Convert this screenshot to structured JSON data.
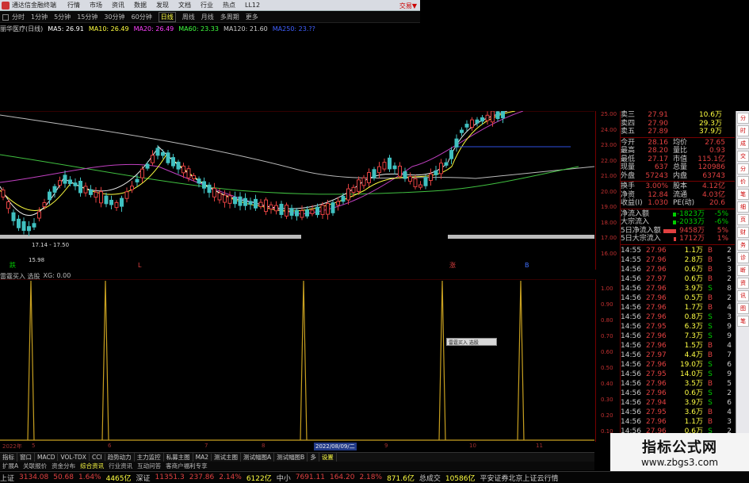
{
  "titlebar": {
    "app_name": "通达信金融终端",
    "menus": [
      "行情",
      "市场",
      "资讯",
      "数据",
      "发现",
      "文档",
      "行业",
      "热点",
      "LL12"
    ],
    "trade": "交易▼"
  },
  "toolbar": {
    "items": [
      "分时",
      "1分钟",
      "5分钟",
      "15分钟",
      "30分钟",
      "60分钟",
      "日线",
      "周线",
      "月线",
      "多周期",
      "更多"
    ],
    "active": "日线"
  },
  "ma_line": [
    {
      "label": "丽华医疗(日线)",
      "color": "#cccccc"
    },
    {
      "label": "MA5: 26.91",
      "color": "#ffffff"
    },
    {
      "label": "MA10: 26.49",
      "color": "#ffff40"
    },
    {
      "label": "MA20: 26.49",
      "color": "#ff40ff"
    },
    {
      "label": "MA60: 23.33",
      "color": "#40ff40"
    },
    {
      "label": "MA120: 21.60",
      "color": "#cccccc"
    },
    {
      "label": "MA250: 23.??",
      "color": "#4060ff"
    }
  ],
  "price_axis": [
    "25.00",
    "24.00",
    "23.00",
    "22.00",
    "21.00",
    "20.00",
    "19.00",
    "18.00",
    "17.00",
    "16.00"
  ],
  "chart_annotations": {
    "range": "17.14 - 17.50",
    "low": "15.98",
    "markers": [
      "跌",
      "L",
      "涨",
      "B"
    ]
  },
  "indicator": {
    "title": "雷霆买入 选股",
    "value": "XG: 0.00"
  },
  "ind_axis": [
    "1.00",
    "0.90",
    "0.80",
    "0.70",
    "0.60",
    "0.50",
    "0.40",
    "0.30",
    "0.20",
    "0.10"
  ],
  "dates": {
    "start": "2022年",
    "ticks": [
      "5",
      "6",
      "7",
      "8",
      "2022/08/09/二",
      "9",
      "10",
      "11"
    ]
  },
  "corner_label": "2022年",
  "popup": "雷霆买入 选股",
  "tabs": [
    "指标",
    "窗口",
    "MACD",
    "VOL-TDX",
    "CCI",
    "趋势动力",
    "主力监控",
    "私募主图",
    "MA2",
    "测试主图",
    "测试幅图A",
    "测试幅图B",
    "多",
    "设置"
  ],
  "subtabs": [
    "扩展A",
    "关联报价",
    "资金分布",
    "综合资讯",
    "行业资讯",
    "互动问答",
    "客商户福利专享"
  ],
  "quote": {
    "ask": [
      {
        "k": "卖三",
        "p": "27.91",
        "v": "10.6万"
      },
      {
        "k": "卖四",
        "p": "27.90",
        "v": "29.3万"
      },
      {
        "k": "卖五",
        "p": "27.89",
        "v": "37.9万"
      }
    ],
    "stats": [
      {
        "k": "今开",
        "v": "28.16",
        "k2": "均价",
        "v2": "27.65"
      },
      {
        "k": "最高",
        "v": "28.20",
        "k2": "量比",
        "v2": "0.93"
      },
      {
        "k": "最低",
        "v": "27.17",
        "k2": "市值",
        "v2": "115.1亿"
      },
      {
        "k": "现量",
        "v": "637",
        "k2": "总量",
        "v2": "120986"
      },
      {
        "k": "外盘",
        "v": "57243",
        "k2": "内盘",
        "v2": "63743"
      }
    ],
    "stats2": [
      {
        "k": "换手",
        "v": "3.00%",
        "k2": "股本",
        "v2": "4.12亿"
      },
      {
        "k": "净资",
        "v": "12.84",
        "k2": "流通",
        "v2": "4.03亿"
      },
      {
        "k": "收益(I)",
        "v": "1.030",
        "k2": "PE(动)",
        "v2": "20.6"
      }
    ],
    "flows": [
      {
        "k": "净流入额",
        "v": "-1823万",
        "p": "-5%",
        "w": 4,
        "color": "#00cc00"
      },
      {
        "k": "大宗流入",
        "v": "-2033万",
        "p": "-6%",
        "w": 4,
        "color": "#00cc00"
      },
      {
        "k": "5日净流入额",
        "v": "9458万",
        "p": "5%",
        "w": 16,
        "color": "#e04040"
      },
      {
        "k": "5日大宗流入",
        "v": "1712万",
        "p": "1%",
        "w": 3,
        "color": "#e04040"
      }
    ],
    "ticks": [
      {
        "t": "14:55",
        "p": "27.96",
        "v": "1.1万",
        "bs": "B",
        "n": "2"
      },
      {
        "t": "14:55",
        "p": "27.96",
        "v": "2.8万",
        "bs": "B",
        "n": "5"
      },
      {
        "t": "14:56",
        "p": "27.96",
        "v": "0.6万",
        "bs": "B",
        "n": "3"
      },
      {
        "t": "14:56",
        "p": "27.97",
        "v": "0.6万",
        "bs": "B",
        "n": "2"
      },
      {
        "t": "14:56",
        "p": "27.96",
        "v": "3.9万",
        "bs": "S",
        "n": "8"
      },
      {
        "t": "14:56",
        "p": "27.96",
        "v": "0.5万",
        "bs": "B",
        "n": "2"
      },
      {
        "t": "14:56",
        "p": "27.96",
        "v": "1.7万",
        "bs": "B",
        "n": "4"
      },
      {
        "t": "14:56",
        "p": "27.96",
        "v": "0.8万",
        "bs": "S",
        "n": "3"
      },
      {
        "t": "14:56",
        "p": "27.95",
        "v": "6.3万",
        "bs": "S",
        "n": "9"
      },
      {
        "t": "14:56",
        "p": "27.96",
        "v": "7.3万",
        "bs": "S",
        "n": "9"
      },
      {
        "t": "14:56",
        "p": "27.96",
        "v": "1.5万",
        "bs": "B",
        "n": "4"
      },
      {
        "t": "14:56",
        "p": "27.97",
        "v": "4.4万",
        "bs": "B",
        "n": "7"
      },
      {
        "t": "14:56",
        "p": "27.96",
        "v": "19.0万",
        "bs": "S",
        "n": "6"
      },
      {
        "t": "14:56",
        "p": "27.95",
        "v": "14.0万",
        "bs": "S",
        "n": "9"
      },
      {
        "t": "14:56",
        "p": "27.96",
        "v": "3.5万",
        "bs": "B",
        "n": "5"
      },
      {
        "t": "14:56",
        "p": "27.96",
        "v": "0.6万",
        "bs": "S",
        "n": "2"
      },
      {
        "t": "14:56",
        "p": "27.94",
        "v": "3.9万",
        "bs": "S",
        "n": "6"
      },
      {
        "t": "14:56",
        "p": "27.95",
        "v": "3.6万",
        "bs": "B",
        "n": "4"
      },
      {
        "t": "14:56",
        "p": "27.96",
        "v": "1.1万",
        "bs": "B",
        "n": "3"
      },
      {
        "t": "14:56",
        "p": "27.96",
        "v": "0.6万",
        "bs": "S",
        "n": "2"
      }
    ]
  },
  "side_tabs": [
    "分",
    "时",
    "成",
    "交",
    "分",
    "价",
    "笔",
    "细",
    "页",
    "财",
    "务",
    "诊",
    "断",
    "资",
    "讯",
    "图",
    "笔"
  ],
  "statusbar": [
    {
      "label": "上证",
      "color": "#cccccc"
    },
    {
      "label": "3134.08",
      "color": "#e04040"
    },
    {
      "label": "50.68",
      "color": "#e04040"
    },
    {
      "label": "1.64%",
      "color": "#e04040"
    },
    {
      "label": "4465亿",
      "color": "#ffff40"
    },
    {
      "label": "深证",
      "color": "#cccccc"
    },
    {
      "label": "11351.3",
      "color": "#e04040"
    },
    {
      "label": "237.86",
      "color": "#e04040"
    },
    {
      "label": "2.14%",
      "color": "#e04040"
    },
    {
      "label": "6122亿",
      "color": "#ffff40"
    },
    {
      "label": "中小",
      "color": "#cccccc"
    },
    {
      "label": "7691.11",
      "color": "#e04040"
    },
    {
      "label": "164.20",
      "color": "#e04040"
    },
    {
      "label": "2.18%",
      "color": "#e04040"
    },
    {
      "label": "871.6亿",
      "color": "#ffff40"
    },
    {
      "label": "总成交",
      "color": "#cccccc"
    },
    {
      "label": "10586亿",
      "color": "#ffff40"
    },
    {
      "label": "平安证券北京上证云行情",
      "color": "#cccccc"
    }
  ],
  "watermark": {
    "title": "指标公式网",
    "url": "www.zbgs3.com"
  }
}
